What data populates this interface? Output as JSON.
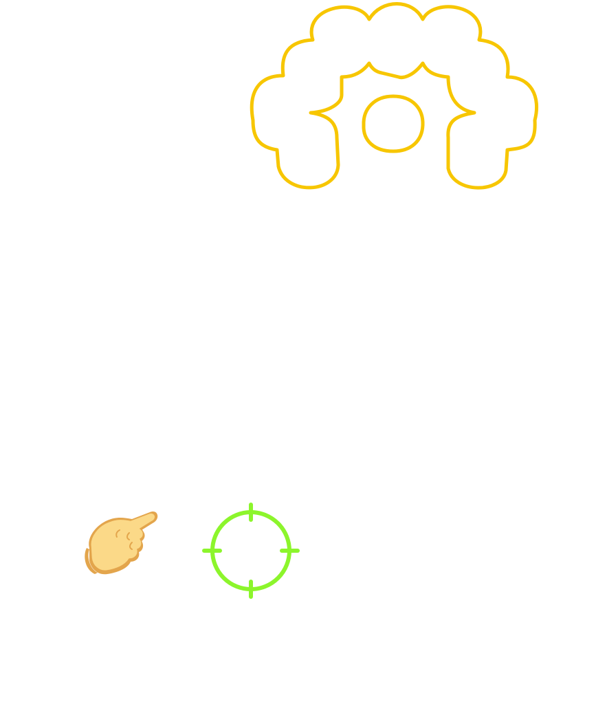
{
  "canvas": {
    "background_color": "#ffffff"
  },
  "trace_shape": {
    "icon": "wavy-arch-outline",
    "stroke_color": "#f7c600"
  },
  "hint_hand": {
    "icon": "pointing-hand-icon",
    "skin_color": "#fbd988",
    "shadow_color": "#e3a54c"
  },
  "target": {
    "icon": "crosshair-target-icon",
    "color": "#8cf52c"
  }
}
